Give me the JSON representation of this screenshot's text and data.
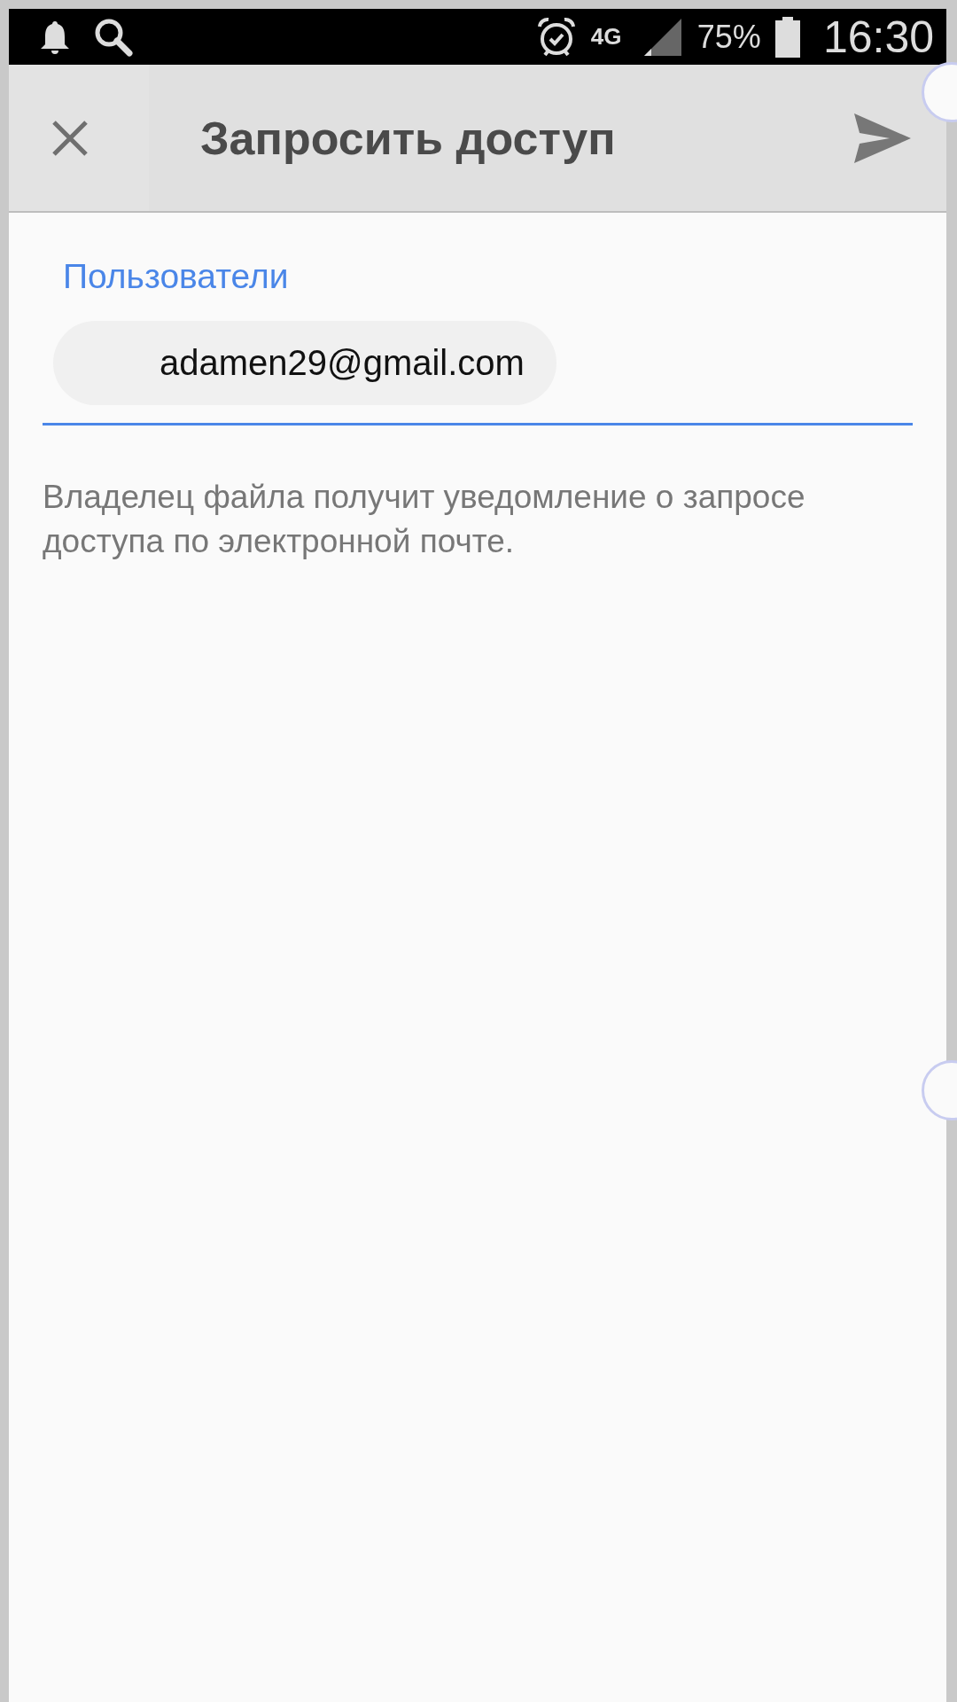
{
  "status_bar": {
    "battery": "75%",
    "time": "16:30",
    "network": "4G"
  },
  "app_bar": {
    "title": "Запросить доступ"
  },
  "recipients": {
    "label": "Пользователи",
    "chips": [
      "adamen29@gmail.com"
    ]
  },
  "note": "Владелец файла получит уведомление о запросе доступа по электронной почте."
}
